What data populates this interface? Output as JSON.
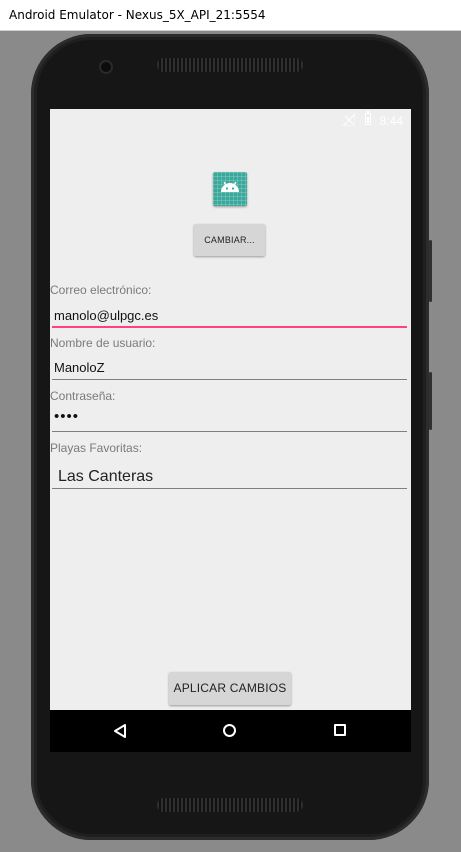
{
  "window": {
    "title": "Android Emulator - Nexus_5X_API_21:5554"
  },
  "status_bar": {
    "time": "8:44",
    "signal_icon": "signal-off-icon",
    "battery_icon": "battery-icon"
  },
  "profile": {
    "avatar_icon": "android-app-icon",
    "change_button": "CAMBIAR..."
  },
  "form": {
    "email": {
      "label": "Correo electrónico:",
      "value": "manolo@ulpgc.es"
    },
    "username": {
      "label": "Nombre de usuario:",
      "value": "ManoloZ"
    },
    "password": {
      "label": "Contraseña:",
      "value": "••••"
    },
    "beaches": {
      "label": "Playas Favoritas:",
      "value": "Las Canteras"
    }
  },
  "apply_button": "APLICAR CAMBIOS",
  "nav_bar": {
    "back_icon": "back-icon",
    "home_icon": "home-icon",
    "recents_icon": "recents-icon"
  },
  "colors": {
    "accent": "#ff4081",
    "app_icon": "#3aa89b",
    "screen_bg": "#eeeeee"
  }
}
